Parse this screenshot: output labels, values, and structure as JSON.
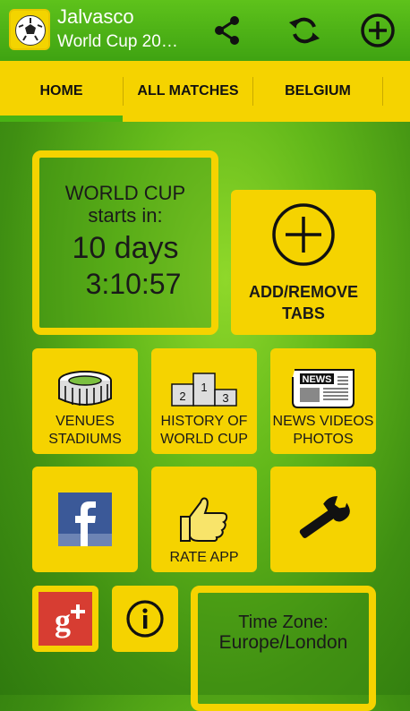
{
  "appbar": {
    "title": "Jalvasco",
    "subtitle": "World Cup 20…",
    "icons": [
      "app-logo-soccer-ball",
      "share-icon",
      "refresh-icon",
      "add-circle-icon"
    ]
  },
  "tabs": [
    {
      "label": "HOME",
      "selected": true
    },
    {
      "label": "ALL MATCHES",
      "selected": false
    },
    {
      "label": "BELGIUM",
      "selected": false
    }
  ],
  "countdown": {
    "line1": "WORLD CUP",
    "line2": "starts in:",
    "days": "10 days",
    "time": "3:10:57"
  },
  "add_remove": {
    "label_line1": "ADD/REMOVE",
    "label_line2": "TABS"
  },
  "tiles": {
    "venues": {
      "line1": "VENUES",
      "line2": "STADIUMS",
      "icon": "stadium-icon"
    },
    "history": {
      "line1": "HISTORY OF",
      "line2": "WORLD CUP",
      "icon": "podium-icon",
      "podium": [
        "2",
        "1",
        "3"
      ]
    },
    "news": {
      "line1": "NEWS VIDEOS",
      "line2": "PHOTOS",
      "icon": "newspaper-icon",
      "badge": "NEWS"
    },
    "facebook": {
      "icon": "facebook-icon"
    },
    "rate": {
      "label": "RATE APP",
      "icon": "thumbs-up-icon"
    },
    "settings": {
      "icon": "wrench-icon"
    },
    "google": {
      "icon": "google-plus-icon"
    },
    "info": {
      "icon": "info-icon"
    }
  },
  "timezone": {
    "line1": "Time Zone:",
    "line2": "Europe/London"
  },
  "colors": {
    "accent": "#f5d300",
    "appbar": "#4caf16",
    "indicator": "#49b314"
  }
}
